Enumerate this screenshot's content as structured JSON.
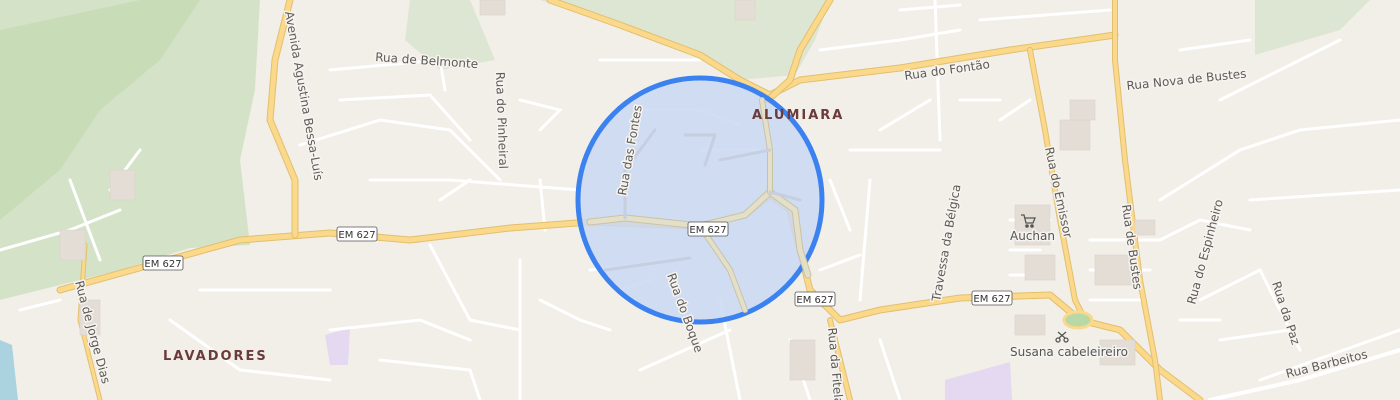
{
  "map": {
    "areas": {
      "alumiara": "ALUMIARA",
      "lavadores": "LAVADORES"
    },
    "streets": {
      "rua_de_belmonte": "Rua de Belmonte",
      "avenida_agustina": "Avenida Agustina Bessa-Luís",
      "rua_do_pinheiral": "Rua do Pinheiral",
      "rua_das_fontes": "Rua das Fontes",
      "rua_do_fontao": "Rua do Fontão",
      "rua_nova_de_bustes": "Rua Nova de Bustes",
      "rua_do_emissor": "Rua do Emissor",
      "travessa_da_belgica": "Travessa da Bélgica",
      "rua_de_bustes": "Rua de Bustes",
      "rua_do_espinheiro": "Rua do Espinheiro",
      "rua_da_paz": "Rua da Paz",
      "rua_barbeitos": "Rua Barbeitos",
      "rua_do_boque": "Rua do Boque",
      "rua_da_fitela": "Rua da Fitela",
      "rua_de_jorge_dias": "Rua de Jorge Dias"
    },
    "road_shield": "EM 627",
    "pois": {
      "auchan": "Auchan",
      "susana": "Susana cabeleireiro"
    },
    "highlight": {
      "fill": "#c9d8f2",
      "stroke": "#3b82f0"
    }
  }
}
